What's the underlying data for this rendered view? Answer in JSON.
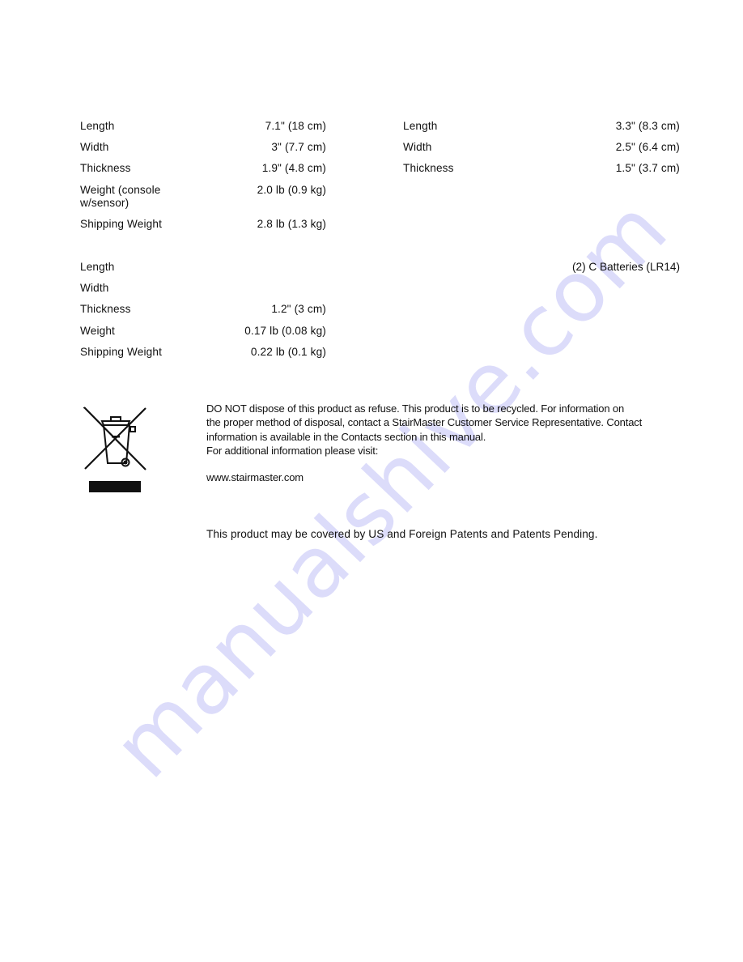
{
  "watermark": {
    "text": "manualshive.com",
    "color": "#dcdcfa"
  },
  "console_specs": {
    "rows": [
      {
        "label": "Length",
        "value": "7.1\" (18 cm)"
      },
      {
        "label": "Width",
        "value": "3\" (7.7 cm)"
      },
      {
        "label": "Thickness",
        "value": "1.9\" (4.8 cm)"
      },
      {
        "label": "Weight (console\nw/sensor)",
        "label_line1": "Weight (console",
        "label_line2": "w/sensor)",
        "value": "2.0 lb (0.9 kg)"
      },
      {
        "label": "Shipping Weight",
        "value": "2.8 lb (1.3 kg)"
      }
    ]
  },
  "sensor_specs": {
    "rows": [
      {
        "label": "Length",
        "value": "3.3\" (8.3 cm)"
      },
      {
        "label": "Width",
        "value": "2.5\" (6.4 cm)"
      },
      {
        "label": "Thickness",
        "value": "1.5\" (3.7 cm)"
      }
    ]
  },
  "strap_specs": {
    "rows": [
      {
        "label": "Length",
        "value": ""
      },
      {
        "label": "Width",
        "value": ""
      },
      {
        "label": "Thickness",
        "value": "1.2\" (3 cm)"
      },
      {
        "label": "Weight",
        "value": "0.17 lb (0.08 kg)"
      },
      {
        "label": "Shipping Weight",
        "value": "0.22 lb (0.1 kg)"
      }
    ]
  },
  "battery": {
    "text": "(2) C Batteries (LR14)"
  },
  "disposal": {
    "icon": "weee-crossed-out-bin-icon",
    "line1": "DO NOT dispose of this product as refuse.  This product is to be recycled.  For information on",
    "line2": "the proper method of disposal, contact a StairMaster Customer Service Representative.  Contact",
    "line3": "information is available in the Contacts section in this manual.",
    "line4": "For additional information please visit:",
    "url": "www.stairmaster.com"
  },
  "patent": {
    "text": "This product may be covered by US and Foreign Patents and Patents Pending."
  }
}
